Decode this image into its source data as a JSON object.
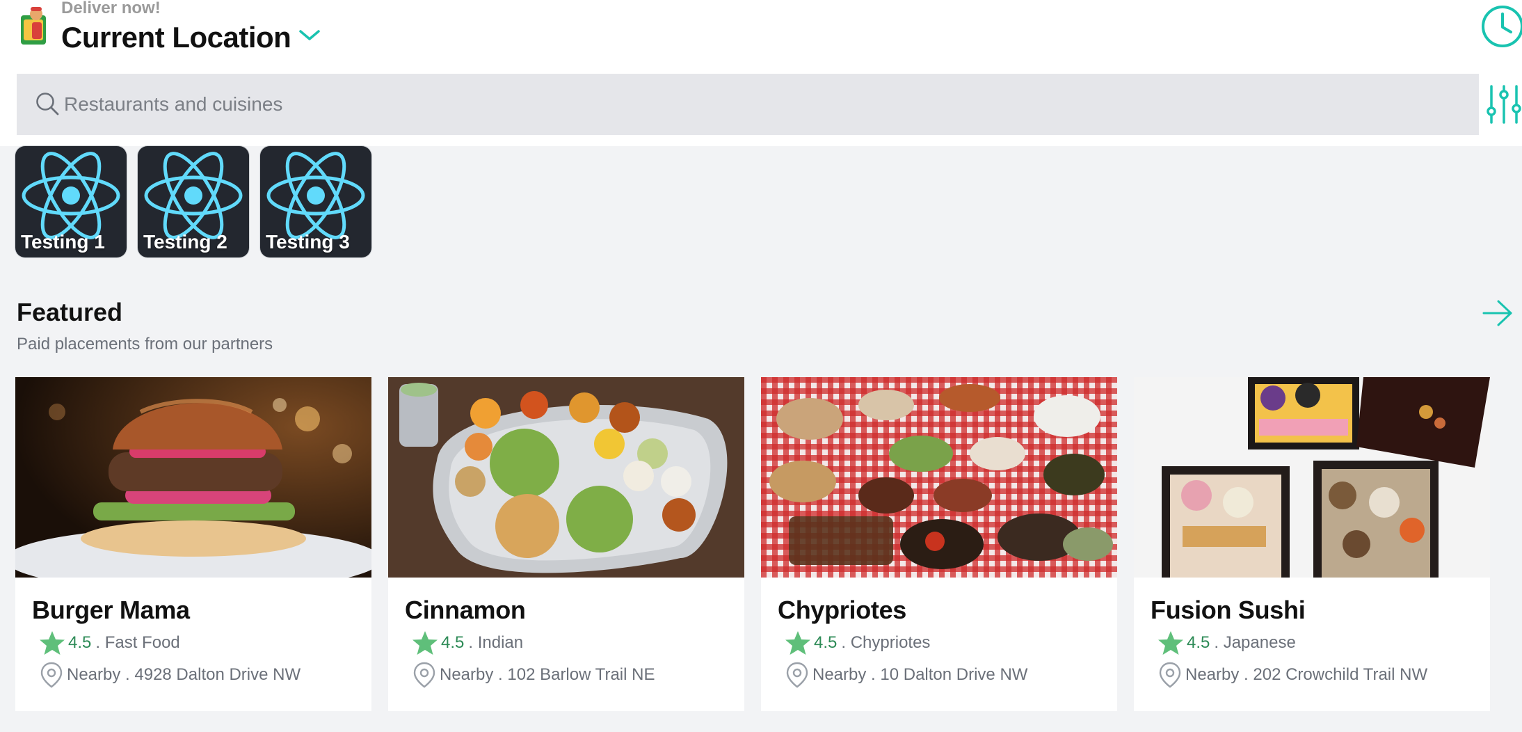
{
  "header": {
    "deliver_label": "Deliver now!",
    "location_title": "Current Location"
  },
  "search": {
    "placeholder": "Restaurants and cuisines",
    "value": ""
  },
  "categories": [
    {
      "label": "Testing 1",
      "icon": "react-atom-icon"
    },
    {
      "label": "Testing 2",
      "icon": "react-atom-icon"
    },
    {
      "label": "Testing 3",
      "icon": "react-atom-icon"
    }
  ],
  "featured": {
    "title": "Featured",
    "subtitle": "Paid placements from our partners"
  },
  "restaurants": [
    {
      "name": "Burger Mama",
      "rating": "4.5",
      "cuisine": ". Fast Food",
      "address": "Nearby . 4928 Dalton Drive NW",
      "image": "burger-photo"
    },
    {
      "name": "Cinnamon",
      "rating": "4.5",
      "cuisine": ". Indian",
      "address": "Nearby . 102 Barlow Trail NE",
      "image": "thali-photo"
    },
    {
      "name": "Chypriotes",
      "rating": "4.5",
      "cuisine": ". Chypriotes",
      "address": "Nearby . 10 Dalton Drive NW",
      "image": "meze-table-photo"
    },
    {
      "name": "Fusion Sushi",
      "rating": "4.5",
      "cuisine": ". Japanese",
      "address": "Nearby . 202 Crowchild Trail NW",
      "image": "bento-box-photo"
    }
  ],
  "colors": {
    "accent": "#19c3b0",
    "star": "#5fbf7a",
    "rating_text": "#2e8b57",
    "background": "#f2f3f5",
    "search_bg": "#e5e6ea",
    "category_tile": "#23272f",
    "react_blue": "#61dafb"
  }
}
